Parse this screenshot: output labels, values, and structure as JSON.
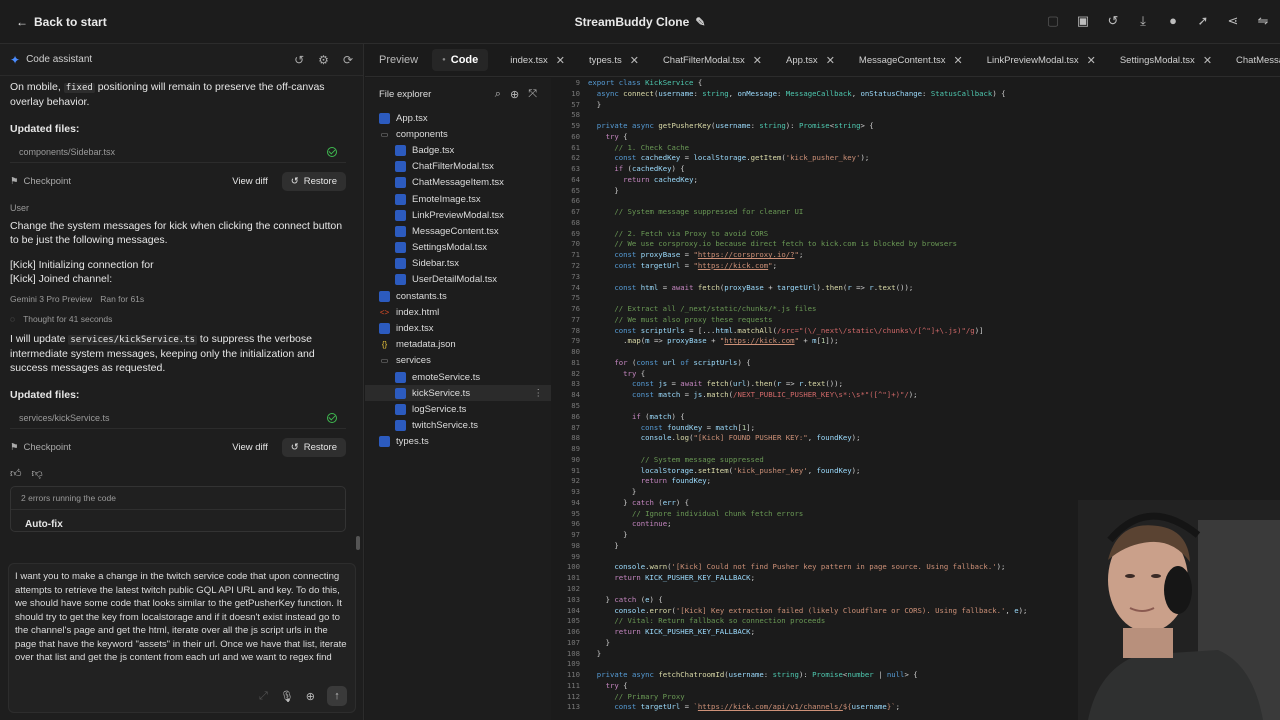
{
  "topbar": {
    "back_label": "Back to start",
    "title": "StreamBuddy Clone"
  },
  "left": {
    "header": "Code assistant",
    "messages": [
      {
        "p1": "On mobile, ",
        "p1code": "fixed",
        "p1b": " positioning will remain to preserve the off-canvas overlay behavior."
      }
    ],
    "updated1": "Updated files:",
    "file1": "components/Sidebar.tsx",
    "checkpoint": "Checkpoint",
    "view_diff": "View diff",
    "restore": "Restore",
    "user_label": "User",
    "user_msg": "Change the system messages for kick when clicking the connect button to be just the following messages.",
    "user_line1": "[Kick] Initializing connection for",
    "user_line2": "[Kick] Joined channel:",
    "model": "Gemini 3 Pro Preview",
    "ran_for": "Ran for 61s",
    "thought": "Thought for 41 seconds",
    "reply_a": "I will update ",
    "reply_code": "services/kickService.ts",
    "reply_b": " to suppress the verbose intermediate system messages, keeping only the initialization and success messages as requested.",
    "updated2": "Updated files:",
    "file2": "services/kickService.ts",
    "errors": "2 errors running the code",
    "autofix": "Auto-fix",
    "input_text": "I want you to make a change in the twitch service code that upon connecting attempts to retrieve the latest twitch public GQL API URL and key. To do this, we should have some code that looks similar to the getPusherKey function. It should try to get the key from localstorage and if it doesn't exist instead go to the channel's page and get the html, iterate over all the js script urls in the page that have the keyword \"assets\" in their url. Once we have that list, iterate over that list and get the js content from each url and we want to regex find"
  },
  "right": {
    "mode_preview": "Preview",
    "mode_code": "Code",
    "tabs": [
      "index.tsx",
      "types.ts",
      "ChatFilterModal.tsx",
      "App.tsx",
      "MessageContent.tsx",
      "LinkPreviewModal.tsx",
      "SettingsModal.tsx",
      "ChatMessageItem.tsx"
    ],
    "explorer_title": "File explorer",
    "tree": [
      {
        "name": "App.tsx",
        "d": 0,
        "k": "tsx"
      },
      {
        "name": "components",
        "d": 0,
        "k": "folder"
      },
      {
        "name": "Badge.tsx",
        "d": 1,
        "k": "tsx"
      },
      {
        "name": "ChatFilterModal.tsx",
        "d": 1,
        "k": "tsx"
      },
      {
        "name": "ChatMessageItem.tsx",
        "d": 1,
        "k": "tsx"
      },
      {
        "name": "EmoteImage.tsx",
        "d": 1,
        "k": "tsx"
      },
      {
        "name": "LinkPreviewModal.tsx",
        "d": 1,
        "k": "tsx"
      },
      {
        "name": "MessageContent.tsx",
        "d": 1,
        "k": "tsx"
      },
      {
        "name": "SettingsModal.tsx",
        "d": 1,
        "k": "tsx"
      },
      {
        "name": "Sidebar.tsx",
        "d": 1,
        "k": "tsx"
      },
      {
        "name": "UserDetailModal.tsx",
        "d": 1,
        "k": "tsx"
      },
      {
        "name": "constants.ts",
        "d": 0,
        "k": "ts"
      },
      {
        "name": "index.html",
        "d": 0,
        "k": "html"
      },
      {
        "name": "index.tsx",
        "d": 0,
        "k": "tsx"
      },
      {
        "name": "metadata.json",
        "d": 0,
        "k": "json"
      },
      {
        "name": "services",
        "d": 0,
        "k": "folder"
      },
      {
        "name": "emoteService.ts",
        "d": 1,
        "k": "ts"
      },
      {
        "name": "kickService.ts",
        "d": 1,
        "k": "ts",
        "sel": true
      },
      {
        "name": "logService.ts",
        "d": 1,
        "k": "ts"
      },
      {
        "name": "twitchService.ts",
        "d": 1,
        "k": "ts"
      },
      {
        "name": "types.ts",
        "d": 0,
        "k": "ts"
      }
    ]
  }
}
